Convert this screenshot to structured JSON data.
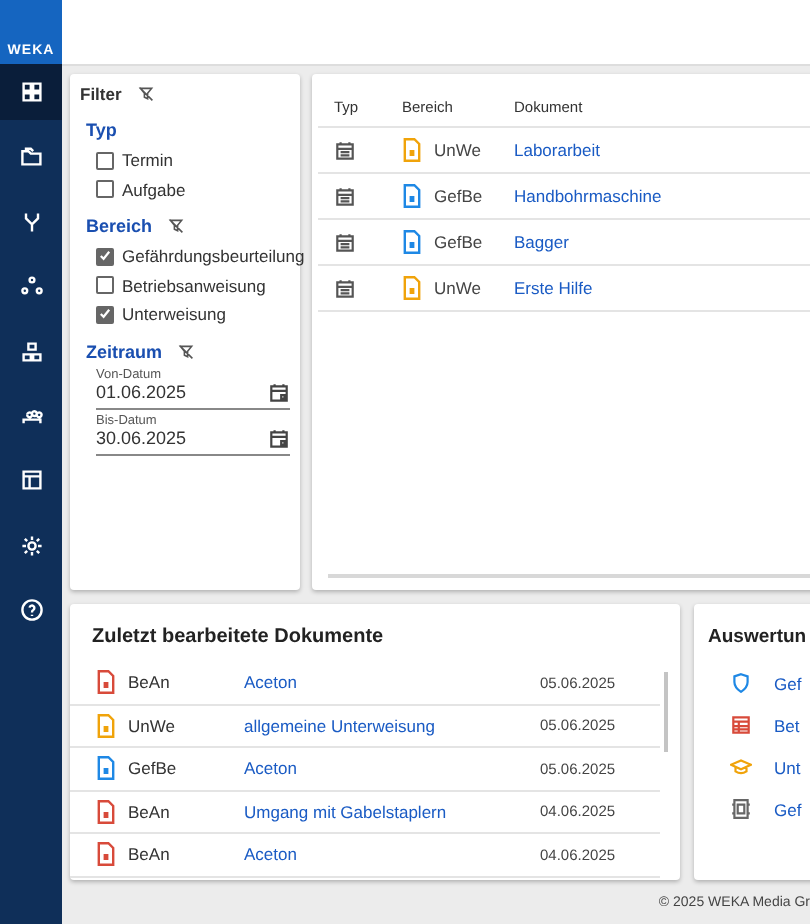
{
  "logo": {
    "text": "WEKA"
  },
  "nav": [
    {
      "kind": "dashboard",
      "selected": true
    },
    {
      "kind": "folders",
      "selected": false
    },
    {
      "kind": "branch",
      "selected": false
    },
    {
      "kind": "nodes",
      "selected": false
    },
    {
      "kind": "hierarchy",
      "selected": false
    },
    {
      "kind": "people",
      "selected": false
    },
    {
      "kind": "layout",
      "selected": false
    },
    {
      "kind": "settings",
      "selected": false
    },
    {
      "kind": "help",
      "selected": false
    }
  ],
  "filter": {
    "title": "Filter",
    "groups": [
      {
        "title": "Typ",
        "clearable": false,
        "options": [
          {
            "label": "Termin",
            "checked": false
          },
          {
            "label": "Aufgabe",
            "checked": false
          }
        ]
      },
      {
        "title": "Bereich",
        "clearable": true,
        "options": [
          {
            "label": "Gefährdungsbeurteilung",
            "checked": true
          },
          {
            "label": "Betriebsanweisung",
            "checked": false
          },
          {
            "label": "Unterweisung",
            "checked": true
          }
        ]
      }
    ],
    "period": {
      "title": "Zeitraum",
      "fields": [
        {
          "label": "Von-Datum",
          "value": "01.06.2025"
        },
        {
          "label": "Bis-Datum",
          "value": "30.06.2025"
        }
      ]
    }
  },
  "table": {
    "columns": [
      "Typ",
      "Bereich",
      "Dokument"
    ],
    "rows": [
      {
        "area": "UnWe",
        "color": "#f0a30a",
        "document": "Laborarbeit"
      },
      {
        "area": "GefBe",
        "color": "#1e88e5",
        "document": "Handbohrmaschine"
      },
      {
        "area": "GefBe",
        "color": "#1e88e5",
        "document": "Bagger"
      },
      {
        "area": "UnWe",
        "color": "#f0a30a",
        "document": "Erste Hilfe"
      }
    ]
  },
  "recent": {
    "title": "Zuletzt bearbeitete Dokumente",
    "rows": [
      {
        "area": "BeAn",
        "color": "#d84a3a",
        "document": "Aceton",
        "date": "05.06.2025"
      },
      {
        "area": "UnWe",
        "color": "#f0a30a",
        "document": "allgemeine Unterweisung",
        "date": "05.06.2025"
      },
      {
        "area": "GefBe",
        "color": "#1e88e5",
        "document": "Aceton",
        "date": "05.06.2025"
      },
      {
        "area": "BeAn",
        "color": "#d84a3a",
        "document": "Umgang mit Gabelstaplern",
        "date": "04.06.2025"
      },
      {
        "area": "BeAn",
        "color": "#d84a3a",
        "document": "Aceton",
        "date": "04.06.2025"
      }
    ]
  },
  "reports": {
    "title": "Auswertun",
    "items": [
      {
        "kind": "shield",
        "label": "Gef"
      },
      {
        "kind": "table",
        "label": "Bet"
      },
      {
        "kind": "cap",
        "label": "Unt"
      },
      {
        "kind": "frame",
        "label": "Gef"
      }
    ]
  },
  "footer": "© 2025 WEKA Media Gr"
}
